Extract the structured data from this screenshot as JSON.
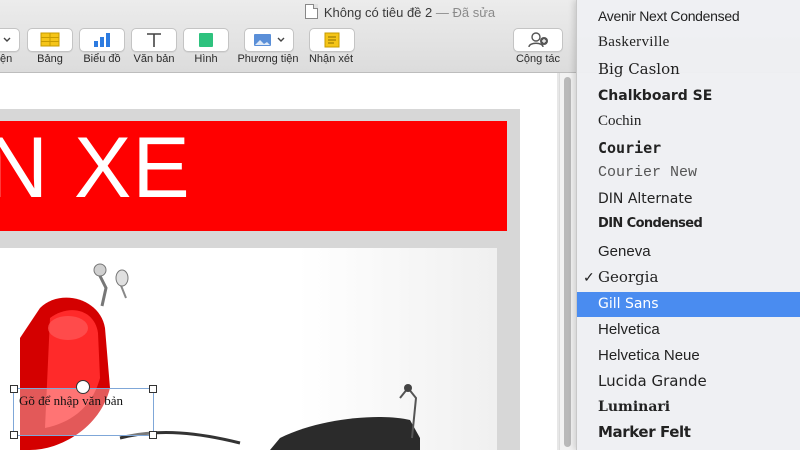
{
  "window": {
    "title": "Không có tiêu đề 2",
    "status": "— Đã sửa"
  },
  "toolbar": {
    "partial_left_label": "ện",
    "table_label": "Bảng",
    "chart_label": "Biểu đồ",
    "text_label": "Văn bản",
    "shape_label": "Hình",
    "media_label": "Phương tiện",
    "comment_label": "Nhận xét",
    "collaborate_label": "Cộng tác",
    "colors": {
      "table": "#f5c518",
      "chart": "#2d7be0",
      "shape": "#2ec27e",
      "comment": "#f5c518"
    }
  },
  "document": {
    "banner_text": "N XE",
    "banner_color": "#ff0000",
    "textbox_placeholder": "Gõ để nhập văn bản"
  },
  "font_menu": {
    "selected_color": "#4a8cf0",
    "checked_font": "Georgia",
    "highlighted_font": "Gill Sans",
    "items": [
      {
        "label": "Avenir Next Condensed"
      },
      {
        "label": "Baskerville"
      },
      {
        "label": "Big Caslon"
      },
      {
        "label": "Chalkboard SE"
      },
      {
        "label": "Cochin"
      },
      {
        "label": "Courier"
      },
      {
        "label": "Courier New"
      },
      {
        "label": "DIN Alternate"
      },
      {
        "label": "DIN Condensed"
      },
      {
        "label": "Geneva"
      },
      {
        "label": "Georgia",
        "checkmark": "✓"
      },
      {
        "label": "Gill Sans"
      },
      {
        "label": "Helvetica"
      },
      {
        "label": "Helvetica Neue"
      },
      {
        "label": "Lucida Grande"
      },
      {
        "label": "Luminari"
      },
      {
        "label": "Marker Felt"
      }
    ]
  }
}
